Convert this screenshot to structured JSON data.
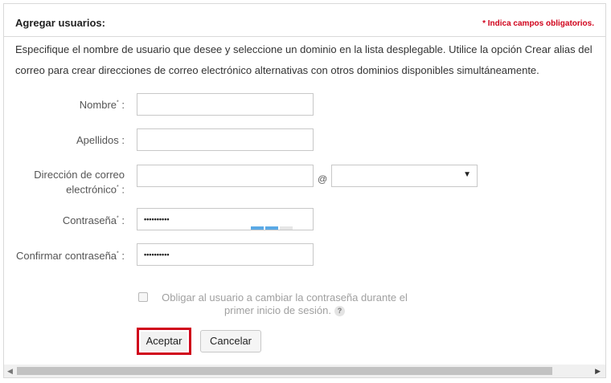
{
  "header": {
    "title": "Agregar usuarios:",
    "required_note": "* Indica campos obligatorios."
  },
  "description": "Especifique el nombre de usuario que desee y seleccione un dominio en la lista desplegable. Utilice la opción Crear alias del correo para crear direcciones de correo electrónico alternativas con otros dominios disponibles simultáneamente.",
  "form": {
    "first_name": {
      "label": "Nombre",
      "value": ""
    },
    "last_name": {
      "label": "Apellidos :",
      "value": ""
    },
    "email": {
      "label_line1": "Dirección de correo",
      "label_line2": "electrónico",
      "value": "",
      "at": "@",
      "domain": ""
    },
    "password": {
      "label": "Contraseña",
      "masked": "••••••••••",
      "strength_colors": [
        "#5aa9e6",
        "#5aa9e6",
        "#e6e6e6"
      ]
    },
    "confirm_password": {
      "label": "Confirmar contraseña",
      "masked": "••••••••••"
    },
    "force_change": {
      "label": "Obligar al usuario a cambiar la contraseña durante el primer inicio de sesión.",
      "checked": false,
      "help": "?"
    }
  },
  "buttons": {
    "accept": "Aceptar",
    "cancel": "Cancelar"
  },
  "colors": {
    "accent_red": "#d0021b"
  }
}
